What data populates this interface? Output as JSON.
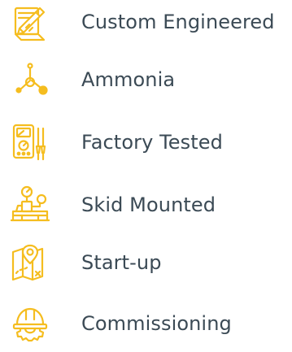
{
  "accent_color": "#f5bd1f",
  "text_color": "#3b4a55",
  "features": [
    {
      "label": "Custom Engineered",
      "icon": "blueprint-design-icon"
    },
    {
      "label": "Ammonia",
      "icon": "molecule-icon"
    },
    {
      "label": "Factory Tested",
      "icon": "multimeter-icon"
    },
    {
      "label": "Skid Mounted",
      "icon": "skid-gauge-icon"
    },
    {
      "label": "Start-up",
      "icon": "map-location-icon"
    },
    {
      "label": "Commissioning",
      "icon": "hardhat-gear-icon"
    }
  ]
}
